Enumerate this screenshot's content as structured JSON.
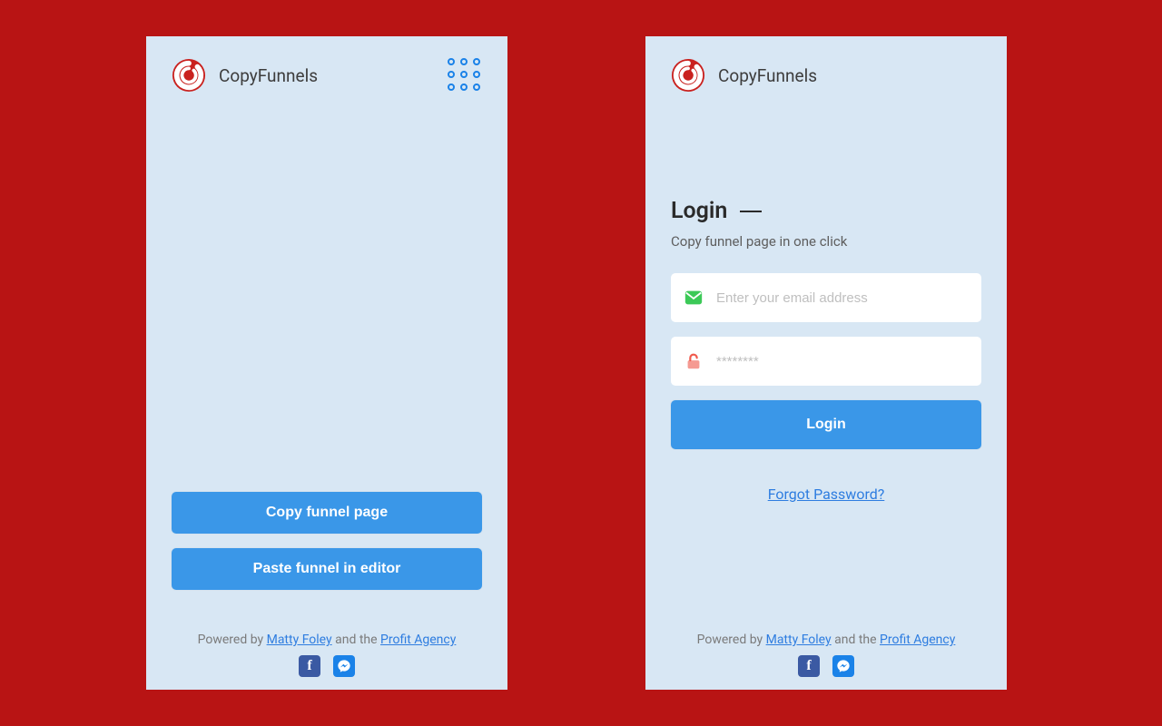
{
  "brand": {
    "name": "CopyFunnels"
  },
  "left": {
    "copy_btn": "Copy funnel page",
    "paste_btn": "Paste funnel in editor"
  },
  "right": {
    "title": "Login",
    "subtitle": "Copy funnel page in one click",
    "email_placeholder": "Enter your email address",
    "password_placeholder": "********",
    "login_btn": "Login",
    "forgot": "Forgot Password?"
  },
  "footer": {
    "powered": "Powered by ",
    "link1": "Matty Foley",
    "mid": " and the ",
    "link2": "Profit Agency"
  }
}
